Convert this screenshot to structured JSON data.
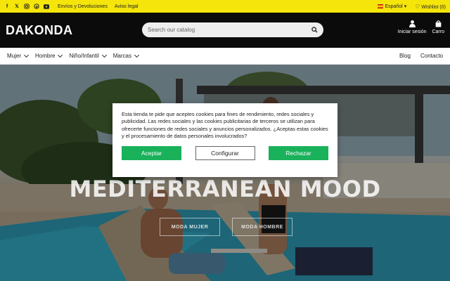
{
  "topbar": {
    "social_icons": [
      "facebook-icon",
      "x-icon",
      "instagram-icon",
      "pinterest-icon",
      "youtube-icon"
    ],
    "links": [
      "Envíos y Devoluciones",
      "Aviso legal"
    ],
    "language": "Español",
    "wishlist": "Wishlist (0)",
    "bg_color": "#f5e50a"
  },
  "header": {
    "logo": "DAKONDA",
    "search_placeholder": "Search our catalog",
    "login_label": "Iniciar sesión",
    "cart_label": "Carro"
  },
  "nav": {
    "items": [
      "Mujer",
      "Hombre",
      "Niño/Infantil",
      "Marcas"
    ],
    "right_items": [
      "Blog",
      "Contacto"
    ]
  },
  "hero": {
    "title": "MEDITERRANEAN MOOD",
    "buttons": [
      "MODA MUJER",
      "MODA HOMBRE"
    ]
  },
  "cookie": {
    "text": "Esta tienda te pide que aceptes cookies para fines de rendimiento, redes sociales y publicidad. Las redes sociales y las cookies publicitarias de terceros se utilizan para ofrecerte funciones de redes sociales y anuncios personalizados. ¿Aceptas estas cookies y el procesamiento de datos personales involucrados?",
    "accept": "Aceptar",
    "configure": "Configurar",
    "reject": "Rechazar",
    "accent_color": "#1ab15b"
  }
}
